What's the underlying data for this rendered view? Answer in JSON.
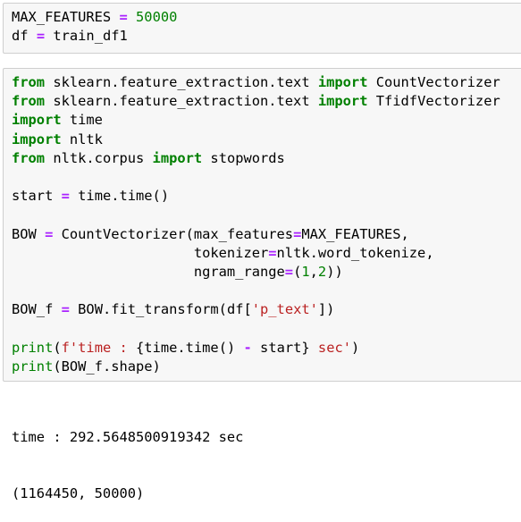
{
  "cells": [
    {
      "lines": [
        [
          {
            "t": "MAX_FEATURES "
          },
          {
            "t": "=",
            "c": "op"
          },
          {
            "t": " "
          },
          {
            "t": "50000",
            "c": "num"
          }
        ],
        [
          {
            "t": "df "
          },
          {
            "t": "=",
            "c": "op"
          },
          {
            "t": " train_df1"
          }
        ]
      ]
    },
    {
      "lines": [
        [
          {
            "t": "from",
            "c": "kw"
          },
          {
            "t": " sklearn.feature_extraction.text "
          },
          {
            "t": "import",
            "c": "kw"
          },
          {
            "t": " CountVectorizer"
          }
        ],
        [
          {
            "t": "from",
            "c": "kw"
          },
          {
            "t": " sklearn.feature_extraction.text "
          },
          {
            "t": "import",
            "c": "kw"
          },
          {
            "t": " TfidfVectorizer"
          }
        ],
        [
          {
            "t": "import",
            "c": "kw"
          },
          {
            "t": " time"
          }
        ],
        [
          {
            "t": "import",
            "c": "kw"
          },
          {
            "t": " nltk"
          }
        ],
        [
          {
            "t": "from",
            "c": "kw"
          },
          {
            "t": " nltk.corpus "
          },
          {
            "t": "import",
            "c": "kw"
          },
          {
            "t": " stopwords"
          }
        ],
        [],
        [
          {
            "t": "start "
          },
          {
            "t": "=",
            "c": "op"
          },
          {
            "t": " time.time()"
          }
        ],
        [],
        [
          {
            "t": "BOW "
          },
          {
            "t": "=",
            "c": "op"
          },
          {
            "t": " CountVectorizer(max_features"
          },
          {
            "t": "=",
            "c": "op"
          },
          {
            "t": "MAX_FEATURES,"
          }
        ],
        [
          {
            "t": "                      tokenizer"
          },
          {
            "t": "=",
            "c": "op"
          },
          {
            "t": "nltk.word_tokenize,"
          }
        ],
        [
          {
            "t": "                      ngram_range"
          },
          {
            "t": "=",
            "c": "op"
          },
          {
            "t": "("
          },
          {
            "t": "1",
            "c": "num"
          },
          {
            "t": ","
          },
          {
            "t": "2",
            "c": "num"
          },
          {
            "t": "))"
          }
        ],
        [],
        [
          {
            "t": "BOW_f "
          },
          {
            "t": "=",
            "c": "op"
          },
          {
            "t": " BOW.fit_transform(df["
          },
          {
            "t": "'p_text'",
            "c": "str"
          },
          {
            "t": "])"
          }
        ],
        [],
        [
          {
            "t": "print",
            "c": "num"
          },
          {
            "t": "("
          },
          {
            "t": "f'time : ",
            "c": "str"
          },
          {
            "t": "{time.time() "
          },
          {
            "t": "-",
            "c": "op"
          },
          {
            "t": " start}"
          },
          {
            "t": " sec'",
            "c": "str"
          },
          {
            "t": ")"
          }
        ],
        [
          {
            "t": "print",
            "c": "num"
          },
          {
            "t": "(BOW_f.shape)"
          }
        ]
      ]
    }
  ],
  "output": {
    "line1": "time : 292.5648500919342 sec",
    "line2": "(1164450, 50000)"
  }
}
